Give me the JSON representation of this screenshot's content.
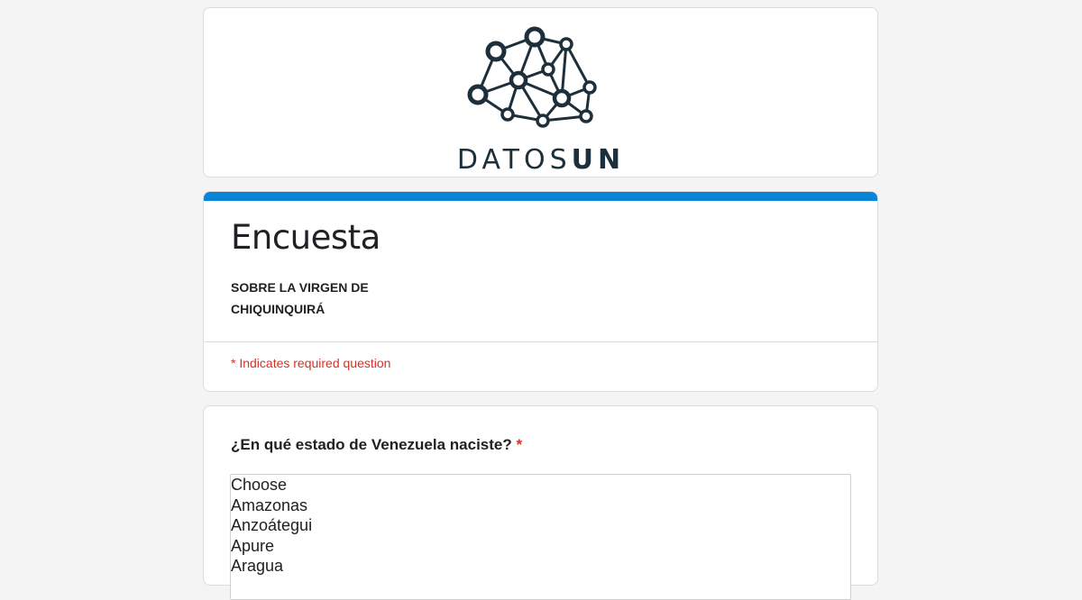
{
  "header": {
    "logo_text_light": "DATOS",
    "logo_text_bold": "UN",
    "logo_icon": "network-graph-icon",
    "logo_color": "#1d2f3a"
  },
  "form": {
    "accent_color": "#0a84d6",
    "title": "Encuesta",
    "description_line1": "SOBRE LA VIRGEN DE",
    "description_line2": "CHIQUINQUIRÁ",
    "required_note": "* Indicates required question"
  },
  "question": {
    "label": "¿En qué estado de Venezuela naciste?",
    "required_mark": "*",
    "options": [
      "Choose",
      "Amazonas",
      "Anzoátegui",
      "Apure",
      "Aragua"
    ]
  }
}
